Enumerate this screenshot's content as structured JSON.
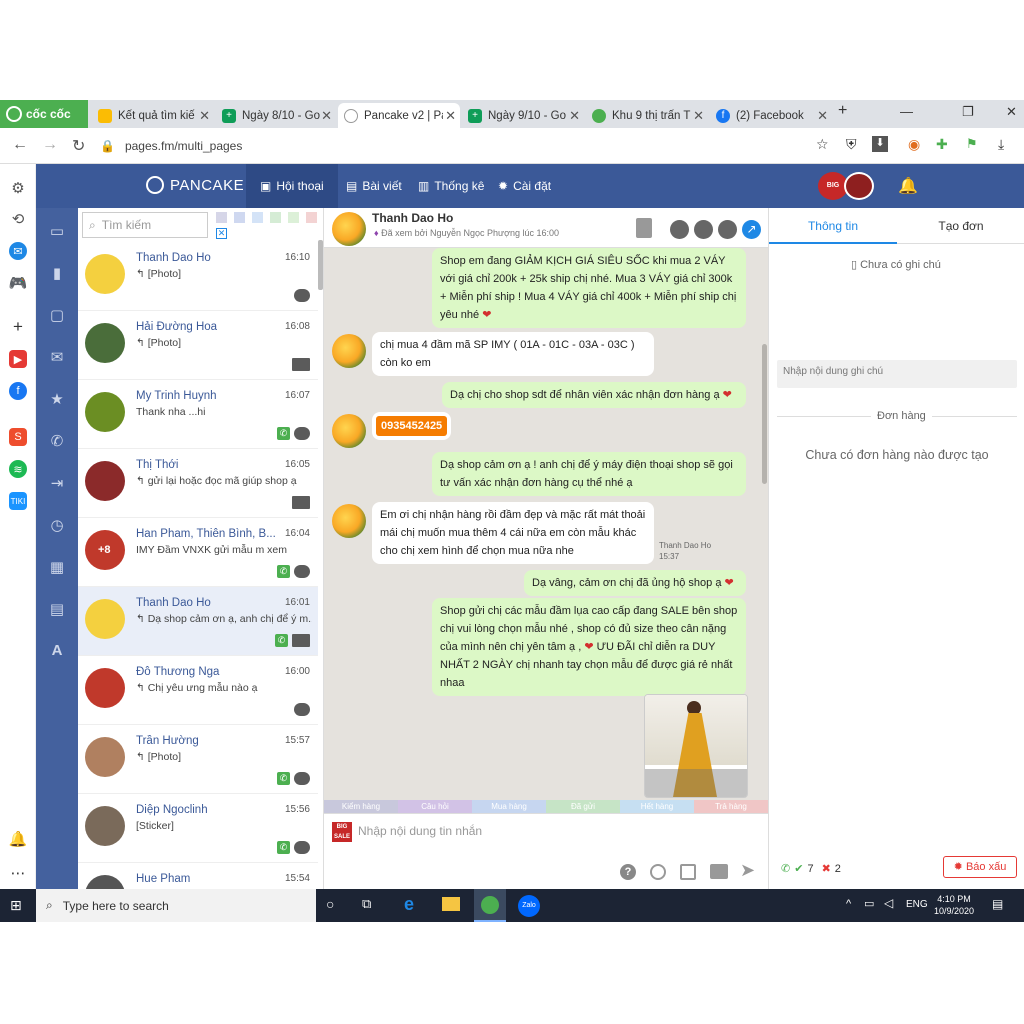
{
  "browser": {
    "brand": "cốc cốc",
    "tabs": [
      {
        "title": "Kết quả tìm kiế",
        "icon": "google-drive-icon"
      },
      {
        "title": "Ngày 8/10 - Go",
        "icon": "google-sheets-icon"
      },
      {
        "title": "Pancake v2 | Pa",
        "icon": "pancake-icon",
        "active": true
      },
      {
        "title": "Ngày 9/10 - Go",
        "icon": "google-sheets-icon"
      },
      {
        "title": "Khu 9 thị trấn T",
        "icon": "coccoc-icon"
      },
      {
        "title": "(2) Facebook",
        "icon": "facebook-icon"
      }
    ],
    "new_tab": "+",
    "url": "pages.fm/multi_pages"
  },
  "app": {
    "brand": "PANCAKE",
    "menu": [
      {
        "label": "Hội thoại",
        "icon": "chat-icon",
        "active": true
      },
      {
        "label": "Bài viết",
        "icon": "post-icon"
      },
      {
        "label": "Thống kê",
        "icon": "stats-icon"
      },
      {
        "label": "Cài đặt",
        "icon": "gear-icon"
      }
    ],
    "badge_text": "BIG SALE"
  },
  "convlist": {
    "search_placeholder": "Tìm kiếm",
    "tag_colors": [
      "#d6d6e8",
      "#cfd8f0",
      "#d4e3f7",
      "#d5ecd5",
      "#dcf0d8",
      "#f3d3d3"
    ],
    "items": [
      {
        "name": "Thanh Dao Ho",
        "time": "16:10",
        "preview": "↰ [Photo]",
        "icons": [
          "chat"
        ],
        "avatar": "#f4d03f"
      },
      {
        "name": "Hải Đường Hoa",
        "time": "16:08",
        "preview": "↰ [Photo]",
        "icons": [
          "mail"
        ],
        "avatar": "#4a6d3a"
      },
      {
        "name": "My Trinh Huynh",
        "time": "16:07",
        "preview": "Thank nha ...hi",
        "icons": [
          "phone",
          "chat"
        ],
        "avatar": "#6b8e23"
      },
      {
        "name": "Thị Thới",
        "time": "16:05",
        "preview": "↰ gửi lại hoặc đọc mã giúp shop ạ",
        "icons": [
          "mail"
        ],
        "avatar": "#8b2a2a"
      },
      {
        "name": "Han Pham, Thiên Bình, B...",
        "time": "16:04",
        "preview": "IMY Đầm VNXK gửi mẫu m xem",
        "icons": [
          "phone",
          "chats"
        ],
        "avatar": "#c0392b",
        "badge": "+8"
      },
      {
        "name": "Thanh Dao Ho",
        "time": "16:01",
        "preview": "↰ Dạ shop cảm ơn ạ, anh chị để ý m...",
        "icons": [
          "phone",
          "mail"
        ],
        "avatar": "#f4d03f",
        "selected": true
      },
      {
        "name": "Đỗ Thương Nga",
        "time": "16:00",
        "preview": "↰ Chị yêu ưng mẫu nào ạ",
        "icons": [
          "chat"
        ],
        "avatar": "#c0392b"
      },
      {
        "name": "Trần Hường",
        "time": "15:57",
        "preview": "↰ [Photo]",
        "icons": [
          "phone",
          "chat"
        ],
        "avatar": "#b08060"
      },
      {
        "name": "Diệp Ngoclinh",
        "time": "15:56",
        "preview": "[Sticker]",
        "icons": [
          "phone",
          "chat"
        ],
        "avatar": "#7a6a5a"
      },
      {
        "name": "Hue Pham",
        "time": "15:54",
        "preview": "",
        "icons": [],
        "avatar": "#555555"
      }
    ]
  },
  "chat": {
    "contact_name": "Thanh Dao Ho",
    "seen_by": "Đã xem bởi Nguyễn Ngọc Phượng lúc 16:00",
    "messages": [
      {
        "side": "right",
        "text": "Shop em đang GIẢM KỊCH GIÁ SIÊU SỐC khi mua 2 VÁY với giá chỉ 200k + 25k ship chị nhé. Mua 3 VÁY giá chỉ 300k + Miễn phí ship ! Mua 4 VÁY giá chỉ 400k + Miễn phí ship chị yêu nhé",
        "heart": true
      },
      {
        "side": "left",
        "text": "chị mua 4 đầm mã SP IMY ( 01A - 01C - 03A - 03C ) còn ko em"
      },
      {
        "side": "right",
        "text": "Dạ chị cho shop sdt để nhân viên xác nhận đơn hàng ạ",
        "heart": true
      },
      {
        "side": "left",
        "phone": "0935452425"
      },
      {
        "side": "right",
        "text": "Dạ shop cảm ơn ạ ! anh chị để ý máy điện thoại shop sẽ gọi tư vấn xác nhận đơn hàng cụ thể nhé ạ"
      },
      {
        "side": "left",
        "text": "Em ơi chị nhận hàng rồi đầm đẹp và mặc rất mát thoải mái chị muốn mua thêm 4 cái nữa em còn mẫu khác cho chị xem hình để chọn mua nữa nhe",
        "sender": "Thanh Dao Ho",
        "time": "15:37"
      },
      {
        "side": "right",
        "text": "Dạ vâng, cảm ơn chị đã ủng hộ shop ạ",
        "heart": true
      },
      {
        "side": "right",
        "text_before": "Shop gửi chị các mẫu đầm lụa cao cấp đang SALE bên shop chị vui lòng chọn mẫu nhé , shop có đủ size theo cân nặng của mình nên chị yên tâm ạ ,",
        "text_after": "ƯU ĐÃI chỉ diễn ra DUY NHẤT 2 NGÀY chị nhanh tay chọn mẫu để được giá rẻ nhất nhaa",
        "heart": true
      }
    ],
    "quick_tags": [
      {
        "label": "Kiểm hàng",
        "color": "#c8c8dc"
      },
      {
        "label": "Câu hỏi",
        "color": "#d2c2e6"
      },
      {
        "label": "Mua hàng",
        "color": "#c6d6f0"
      },
      {
        "label": "Đã gửi",
        "color": "#c6e4c6"
      },
      {
        "label": "Hết hàng",
        "color": "#c6dff2"
      },
      {
        "label": "Trả hàng",
        "color": "#f0c6c6"
      }
    ],
    "input_placeholder": "Nhập nội dung tin nhắn"
  },
  "right_panel": {
    "tabs": [
      "Thông tin",
      "Tạo đơn"
    ],
    "no_note": "Chưa có ghi chú",
    "note_placeholder": "Nhập nội dung ghi chú",
    "orders_title": "Đơn hàng",
    "no_orders": "Chưa có đơn hàng nào được tạo",
    "ok_count": "7",
    "fail_count": "2",
    "report_button": "Báo xấu"
  },
  "taskbar": {
    "search_text": "Type here to search",
    "lang": "ENG",
    "time": "4:10 PM",
    "date": "10/9/2020"
  }
}
